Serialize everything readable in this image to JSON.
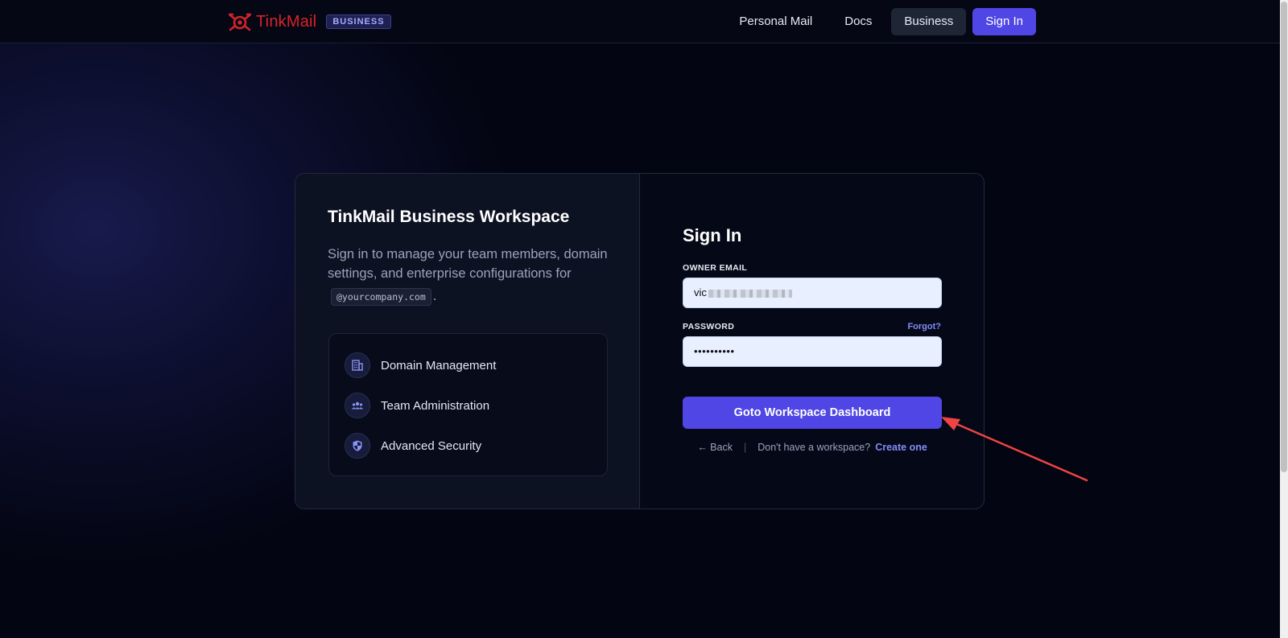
{
  "header": {
    "brand_name": "TinkMail",
    "brand_badge": "BUSINESS",
    "nav": {
      "personal_mail": "Personal Mail",
      "docs": "Docs",
      "business": "Business",
      "sign_in": "Sign In"
    }
  },
  "left": {
    "title": "TinkMail Business Workspace",
    "description": "Sign in to manage your team members, domain settings, and enterprise configurations for",
    "domain_chip": "@yourcompany.com",
    "trailing": ".",
    "features": [
      {
        "label": "Domain Management",
        "icon": "building-icon"
      },
      {
        "label": "Team Administration",
        "icon": "group-icon"
      },
      {
        "label": "Advanced Security",
        "icon": "shield-icon"
      }
    ]
  },
  "form": {
    "title": "Sign In",
    "email_label": "OWNER EMAIL",
    "email_value_visible": "vic",
    "password_label": "PASSWORD",
    "forgot": "Forgot?",
    "password_value": "••••••••••",
    "submit": "Goto Workspace Dashboard",
    "back": "← Back",
    "separator": "|",
    "no_workspace": "Don't have a workspace?",
    "create": "Create one"
  },
  "colors": {
    "accent": "#4f46e5",
    "brand_red": "#d8232a",
    "link": "#818cf8"
  }
}
